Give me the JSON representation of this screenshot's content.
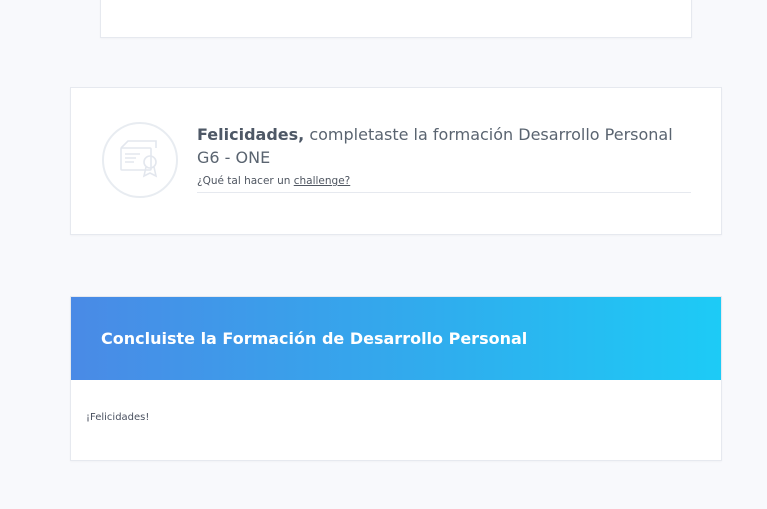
{
  "congrats_card": {
    "title_strong": "Felicidades,",
    "title_rest": " completaste la formación Desarrollo Personal G6 - ONE",
    "challenge_prefix": "¿Qué tal hacer un ",
    "challenge_link": "challenge?",
    "icon": "certificate-icon"
  },
  "concluded_card": {
    "header_title": "Concluiste la Formación de Desarrollo Personal",
    "body_text": "¡Felicidades!"
  },
  "colors": {
    "page_background": "#f8f9fc",
    "gradient_start": "#4a8ae6",
    "gradient_end": "#1dcbf6"
  }
}
